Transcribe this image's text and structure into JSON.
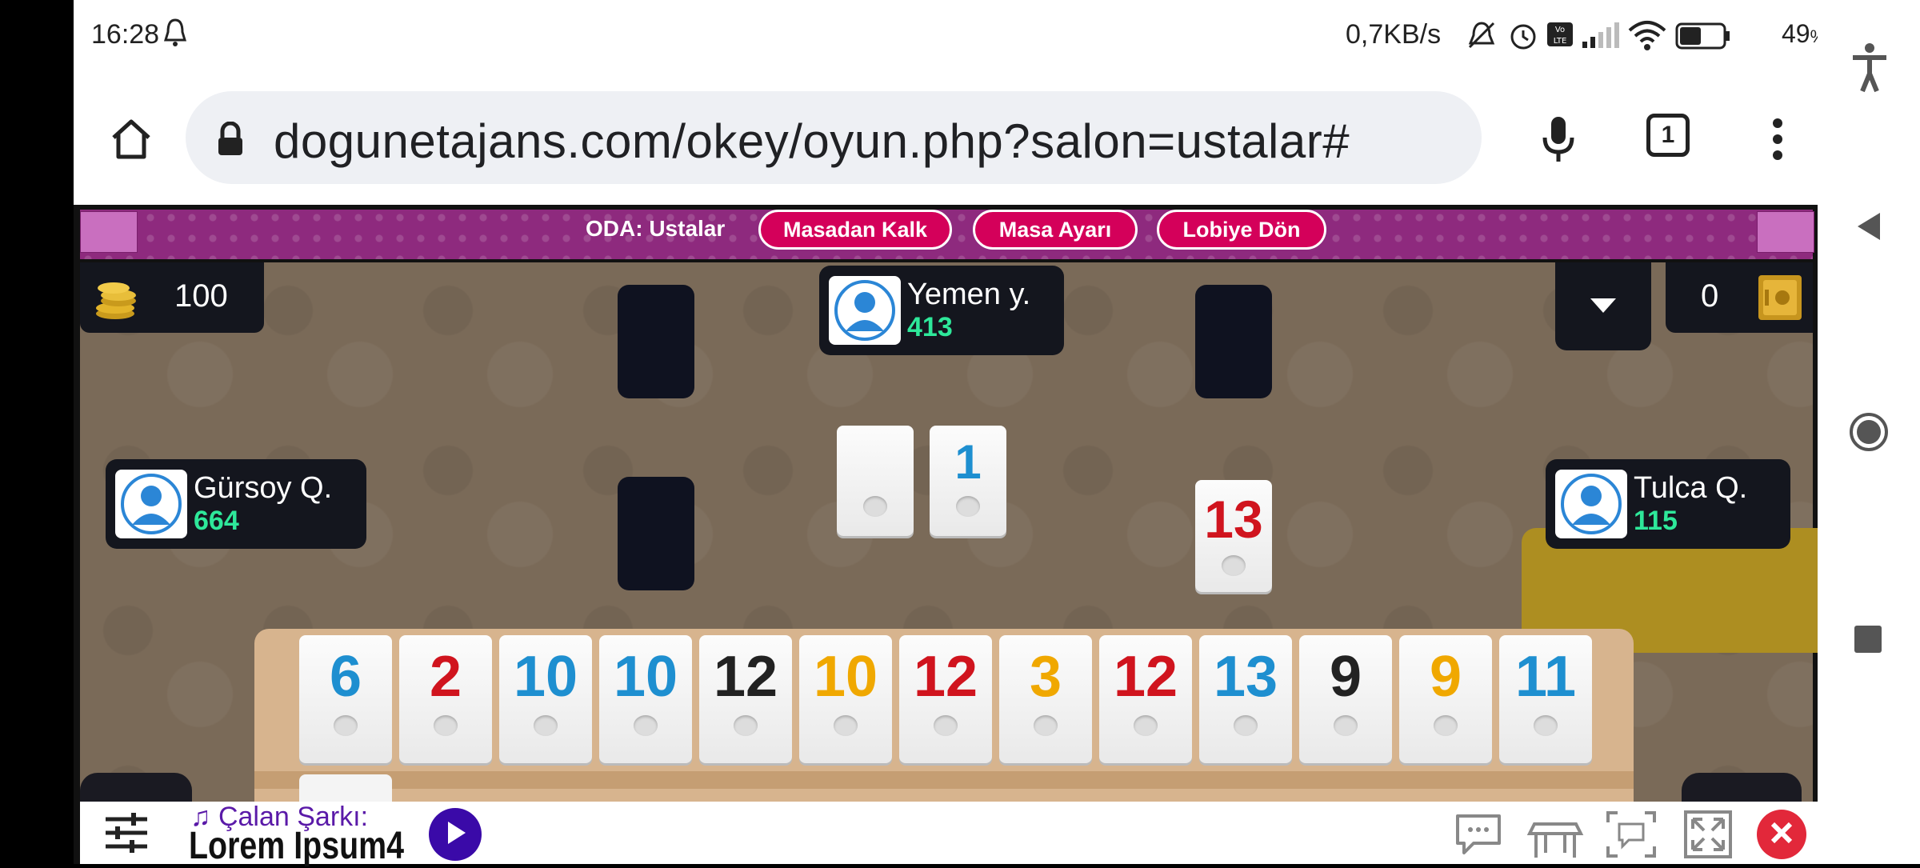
{
  "status_bar": {
    "time": "16:28",
    "network_speed": "0,7KB/s",
    "battery_percent": "49",
    "battery_suffix": "%"
  },
  "browser": {
    "url": "dogunetajans.com/okey/oyun.php?salon=ustalar#",
    "tab_count": "1"
  },
  "game": {
    "room_label": "ODA: Ustalar",
    "buttons": [
      "Masadan Kalk",
      "Masa Ayarı",
      "Lobiye Dön"
    ],
    "chips": "100",
    "right_counter": "0",
    "players": {
      "top": {
        "name": "Yemen y.",
        "score": "413"
      },
      "left": {
        "name": "Gürsoy Q.",
        "score": "664"
      },
      "right": {
        "name": "Tulca Q.",
        "score": "115"
      }
    },
    "center_tiles": [
      {
        "value": "",
        "color": "#2a2a2a"
      },
      {
        "value": "1",
        "color": "#1e8fd0"
      }
    ],
    "discard_tile": {
      "value": "13",
      "color": "#d0141e"
    },
    "rack_tiles": [
      {
        "value": "6",
        "color": "#1e8fd0"
      },
      {
        "value": "2",
        "color": "#d0141e"
      },
      {
        "value": "10",
        "color": "#1e8fd0"
      },
      {
        "value": "10",
        "color": "#1e8fd0"
      },
      {
        "value": "12",
        "color": "#222222"
      },
      {
        "value": "10",
        "color": "#f0a800"
      },
      {
        "value": "12",
        "color": "#d0141e"
      },
      {
        "value": "3",
        "color": "#f0a800"
      },
      {
        "value": "12",
        "color": "#d0141e"
      },
      {
        "value": "13",
        "color": "#1e8fd0"
      },
      {
        "value": "9",
        "color": "#222222"
      },
      {
        "value": "9",
        "color": "#f0a800"
      },
      {
        "value": "11",
        "color": "#1e8fd0"
      }
    ]
  },
  "music": {
    "now_playing_label": "♫ Çalan Şarkı:",
    "song_title": "Lorem Ipsum4"
  },
  "colors": {
    "banner": "#8e2a7e",
    "button_fill": "#d4005a",
    "score_green": "#2ee89a",
    "close_red": "#e2283a",
    "play_purple": "#3a0aa8"
  }
}
